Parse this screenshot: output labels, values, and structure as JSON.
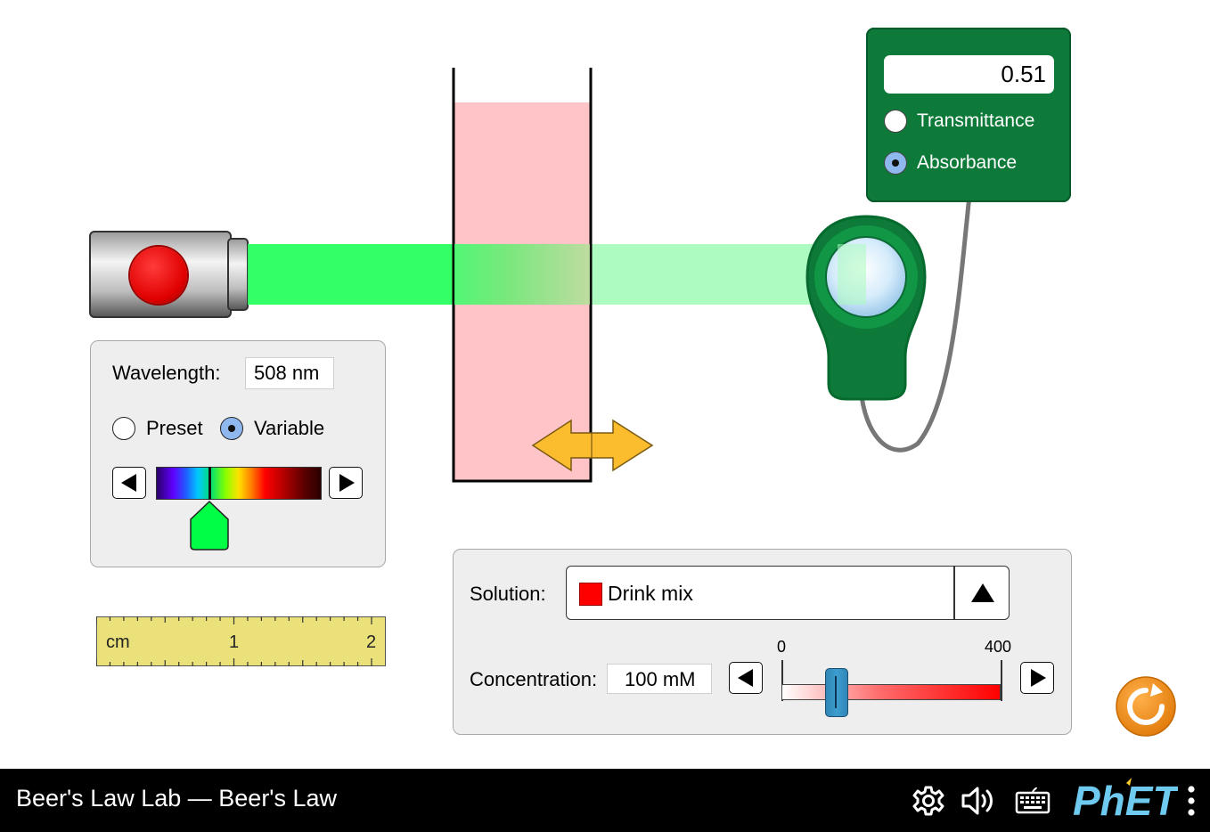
{
  "meter": {
    "value": "0.51",
    "options": [
      {
        "label": "Transmittance",
        "selected": false
      },
      {
        "label": "Absorbance",
        "selected": true
      }
    ]
  },
  "wavelength_panel": {
    "label": "Wavelength:",
    "value": "508 nm",
    "modes": [
      {
        "label": "Preset",
        "selected": false
      },
      {
        "label": "Variable",
        "selected": true
      }
    ]
  },
  "ruler": {
    "unit": "cm",
    "marks": [
      "1",
      "2"
    ]
  },
  "solution_panel": {
    "solution_label": "Solution:",
    "solution_value": "Drink mix",
    "solution_color": "#ff0000",
    "concentration_label": "Concentration:",
    "concentration_value": "100 mM",
    "slider_min": "0",
    "slider_max": "400"
  },
  "footer": {
    "title": "Beer's Law Lab — Beer's Law",
    "brand": "PhET"
  },
  "colors": {
    "beam": "#33ff66",
    "solution_fill": "#ffc4c8",
    "meter_green": "#0d7a3a",
    "reset_orange": "#f3921f",
    "arrow_yellow": "#fbbd2e"
  }
}
